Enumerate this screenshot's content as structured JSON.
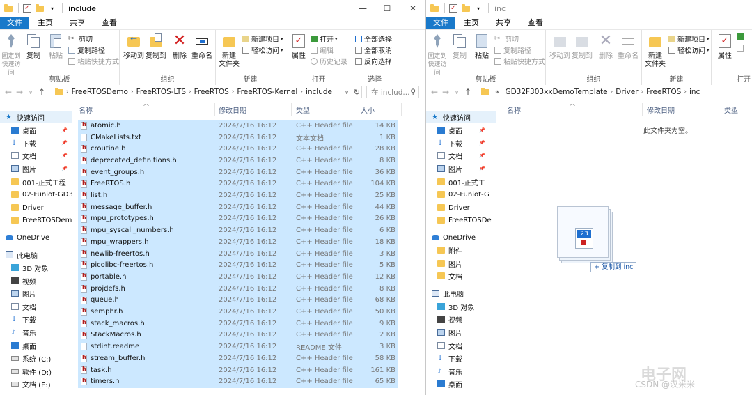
{
  "left_window": {
    "title": "include",
    "ribbon_tabs": [
      "文件",
      "主页",
      "共享",
      "查看"
    ],
    "ribbon": {
      "clipboard": {
        "pin": "固定到快速访问",
        "copy": "复制",
        "paste": "粘贴",
        "cut": "剪切",
        "copy_path": "复制路径",
        "paste_shortcut": "粘贴快捷方式",
        "label": "剪贴板"
      },
      "organize": {
        "move_to": "移动到",
        "copy_to": "复制到",
        "delete": "删除",
        "rename": "重命名",
        "label": "组织"
      },
      "new": {
        "new_folder": "新建\n文件夹",
        "new_item": "新建项目",
        "easy_access": "轻松访问",
        "label": "新建"
      },
      "open": {
        "properties": "属性",
        "open": "打开",
        "edit": "编辑",
        "history": "历史记录",
        "label": "打开"
      },
      "select": {
        "select_all": "全部选择",
        "select_none": "全部取消",
        "invert": "反向选择",
        "label": "选择"
      }
    },
    "breadcrumb": [
      "FreeRTOSDemo",
      "FreeRTOS-LTS",
      "FreeRTOS",
      "FreeRTOS-Kernel",
      "include"
    ],
    "search_placeholder": "在 includ...",
    "columns": {
      "name": "名称",
      "date": "修改日期",
      "type": "类型",
      "size": "大小"
    },
    "nav": [
      {
        "label": "快速访问",
        "icon": "star-icon",
        "pinned": false
      },
      {
        "label": "桌面",
        "icon": "desktop-icon",
        "pinned": true
      },
      {
        "label": "下载",
        "icon": "download-icon",
        "pinned": true
      },
      {
        "label": "文档",
        "icon": "document-icon",
        "pinned": true
      },
      {
        "label": "图片",
        "icon": "picture-icon",
        "pinned": true
      },
      {
        "label": "001-正式工程",
        "icon": "folder-icon",
        "pinned": false
      },
      {
        "label": "02-Funiot-GD3",
        "icon": "folder-icon",
        "pinned": false
      },
      {
        "label": "Driver",
        "icon": "folder-icon",
        "pinned": false
      },
      {
        "label": "FreeRTOSDemo",
        "icon": "folder-icon",
        "pinned": false
      },
      {
        "label": "OneDrive",
        "icon": "cloud-icon",
        "pinned": false
      },
      {
        "label": "此电脑",
        "icon": "pc-icon",
        "pinned": false
      },
      {
        "label": "3D 对象",
        "icon": "cube-icon",
        "pinned": false
      },
      {
        "label": "视频",
        "icon": "video-icon",
        "pinned": false
      },
      {
        "label": "图片",
        "icon": "picture-icon",
        "pinned": false
      },
      {
        "label": "文档",
        "icon": "document-icon",
        "pinned": false
      },
      {
        "label": "下载",
        "icon": "download-icon",
        "pinned": false
      },
      {
        "label": "音乐",
        "icon": "music-icon",
        "pinned": false
      },
      {
        "label": "桌面",
        "icon": "desktop-icon",
        "pinned": false
      },
      {
        "label": "系统 (C:)",
        "icon": "drive-icon",
        "pinned": false
      },
      {
        "label": "软件 (D:)",
        "icon": "drive-icon",
        "pinned": false
      },
      {
        "label": "文档 (E:)",
        "icon": "drive-icon",
        "pinned": false
      }
    ],
    "files": [
      {
        "name": "atomic.h",
        "date": "2024/7/16 16:12",
        "type": "C++ Header file",
        "size": "14 KB",
        "kind": "h"
      },
      {
        "name": "CMakeLists.txt",
        "date": "2024/7/16 16:12",
        "type": "文本文档",
        "size": "1 KB",
        "kind": "txt"
      },
      {
        "name": "croutine.h",
        "date": "2024/7/16 16:12",
        "type": "C++ Header file",
        "size": "28 KB",
        "kind": "h"
      },
      {
        "name": "deprecated_definitions.h",
        "date": "2024/7/16 16:12",
        "type": "C++ Header file",
        "size": "8 KB",
        "kind": "h"
      },
      {
        "name": "event_groups.h",
        "date": "2024/7/16 16:12",
        "type": "C++ Header file",
        "size": "36 KB",
        "kind": "h"
      },
      {
        "name": "FreeRTOS.h",
        "date": "2024/7/16 16:12",
        "type": "C++ Header file",
        "size": "104 KB",
        "kind": "h"
      },
      {
        "name": "list.h",
        "date": "2024/7/16 16:12",
        "type": "C++ Header file",
        "size": "25 KB",
        "kind": "h"
      },
      {
        "name": "message_buffer.h",
        "date": "2024/7/16 16:12",
        "type": "C++ Header file",
        "size": "44 KB",
        "kind": "h"
      },
      {
        "name": "mpu_prototypes.h",
        "date": "2024/7/16 16:12",
        "type": "C++ Header file",
        "size": "26 KB",
        "kind": "h"
      },
      {
        "name": "mpu_syscall_numbers.h",
        "date": "2024/7/16 16:12",
        "type": "C++ Header file",
        "size": "6 KB",
        "kind": "h"
      },
      {
        "name": "mpu_wrappers.h",
        "date": "2024/7/16 16:12",
        "type": "C++ Header file",
        "size": "18 KB",
        "kind": "h"
      },
      {
        "name": "newlib-freertos.h",
        "date": "2024/7/16 16:12",
        "type": "C++ Header file",
        "size": "3 KB",
        "kind": "h"
      },
      {
        "name": "picolibc-freertos.h",
        "date": "2024/7/16 16:12",
        "type": "C++ Header file",
        "size": "5 KB",
        "kind": "h"
      },
      {
        "name": "portable.h",
        "date": "2024/7/16 16:12",
        "type": "C++ Header file",
        "size": "12 KB",
        "kind": "h"
      },
      {
        "name": "projdefs.h",
        "date": "2024/7/16 16:12",
        "type": "C++ Header file",
        "size": "8 KB",
        "kind": "h"
      },
      {
        "name": "queue.h",
        "date": "2024/7/16 16:12",
        "type": "C++ Header file",
        "size": "68 KB",
        "kind": "h"
      },
      {
        "name": "semphr.h",
        "date": "2024/7/16 16:12",
        "type": "C++ Header file",
        "size": "50 KB",
        "kind": "h"
      },
      {
        "name": "stack_macros.h",
        "date": "2024/7/16 16:12",
        "type": "C++ Header file",
        "size": "9 KB",
        "kind": "h"
      },
      {
        "name": "StackMacros.h",
        "date": "2024/7/16 16:12",
        "type": "C++ Header file",
        "size": "2 KB",
        "kind": "h"
      },
      {
        "name": "stdint.readme",
        "date": "2024/7/16 16:12",
        "type": "README 文件",
        "size": "3 KB",
        "kind": "txt"
      },
      {
        "name": "stream_buffer.h",
        "date": "2024/7/16 16:12",
        "type": "C++ Header file",
        "size": "58 KB",
        "kind": "h"
      },
      {
        "name": "task.h",
        "date": "2024/7/16 16:12",
        "type": "C++ Header file",
        "size": "161 KB",
        "kind": "h"
      },
      {
        "name": "timers.h",
        "date": "2024/7/16 16:12",
        "type": "C++ Header file",
        "size": "65 KB",
        "kind": "h"
      }
    ]
  },
  "right_window": {
    "title": "inc",
    "ribbon_tabs": [
      "文件",
      "主页",
      "共享",
      "查看"
    ],
    "ribbon_partial_label": "打开",
    "breadcrumb_prefix": "«",
    "breadcrumb": [
      "GD32F303xxDemoTemplate",
      "Driver",
      "FreeRTOS",
      "inc"
    ],
    "columns": {
      "name": "名称",
      "date": "修改日期",
      "type": "类型"
    },
    "empty_message": "此文件夹为空。",
    "nav": [
      {
        "label": "快速访问",
        "icon": "star-icon",
        "pinned": false
      },
      {
        "label": "桌面",
        "icon": "desktop-icon",
        "pinned": true
      },
      {
        "label": "下载",
        "icon": "download-icon",
        "pinned": true
      },
      {
        "label": "文档",
        "icon": "document-icon",
        "pinned": true
      },
      {
        "label": "图片",
        "icon": "picture-icon",
        "pinned": true
      },
      {
        "label": "001-正式工",
        "icon": "folder-icon",
        "pinned": false
      },
      {
        "label": "02-Funiot-G",
        "icon": "folder-icon",
        "pinned": false
      },
      {
        "label": "Driver",
        "icon": "folder-icon",
        "pinned": false
      },
      {
        "label": "FreeRTOSDe",
        "icon": "folder-icon",
        "pinned": false
      },
      {
        "label": "OneDrive",
        "icon": "cloud-icon",
        "pinned": false
      },
      {
        "label": "附件",
        "icon": "folder-icon",
        "pinned": false
      },
      {
        "label": "图片",
        "icon": "folder-icon",
        "pinned": false
      },
      {
        "label": "文档",
        "icon": "folder-icon",
        "pinned": false
      },
      {
        "label": "此电脑",
        "icon": "pc-icon",
        "pinned": false
      },
      {
        "label": "3D 对象",
        "icon": "cube-icon",
        "pinned": false
      },
      {
        "label": "视频",
        "icon": "video-icon",
        "pinned": false
      },
      {
        "label": "图片",
        "icon": "picture-icon",
        "pinned": false
      },
      {
        "label": "文档",
        "icon": "document-icon",
        "pinned": false
      },
      {
        "label": "下载",
        "icon": "download-icon",
        "pinned": false
      },
      {
        "label": "音乐",
        "icon": "music-icon",
        "pinned": false
      },
      {
        "label": "桌面",
        "icon": "desktop-icon",
        "pinned": false
      }
    ]
  },
  "drag": {
    "badge": "23",
    "tooltip": "+ 复制到 inc"
  },
  "watermark": {
    "main": "电子网",
    "sub": "CSDN @汉米米"
  },
  "colors": {
    "accent": "#1979ca",
    "selection": "#cce8ff",
    "header_text": "#4d6082",
    "folder": "#f6c754"
  }
}
